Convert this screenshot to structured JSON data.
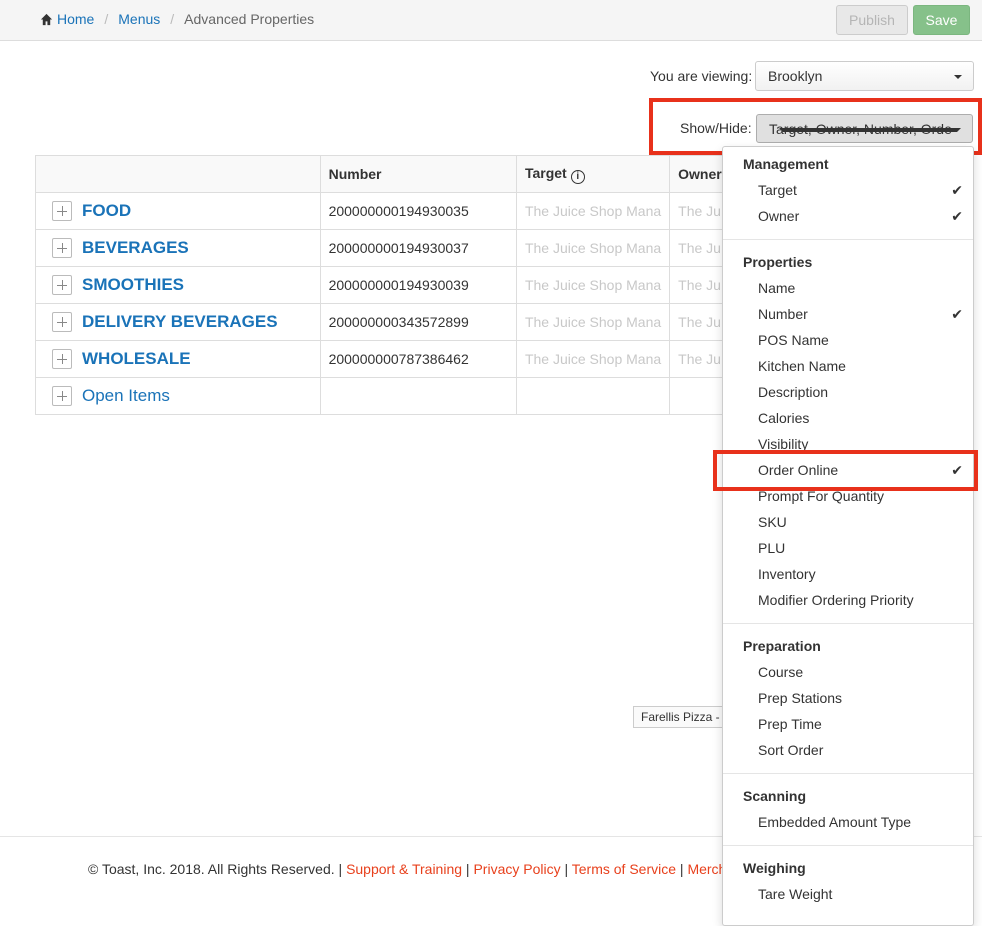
{
  "breadcrumb": {
    "home": "Home",
    "menus": "Menus",
    "current": "Advanced Properties"
  },
  "toolbar": {
    "publish_label": "Publish",
    "save_label": "Save"
  },
  "viewing": {
    "label": "You are viewing:",
    "value": "Brooklyn"
  },
  "showhide": {
    "label": "Show/Hide:",
    "value": "Target, Owner, Number, Order Online"
  },
  "table": {
    "headers": {
      "name": "",
      "number": "Number",
      "target": "Target",
      "owner": "Owner"
    },
    "rows": [
      {
        "name": "FOOD",
        "number": "200000000194930035",
        "target": "The Juice Shop Mana",
        "owner": "The Ju"
      },
      {
        "name": "BEVERAGES",
        "number": "200000000194930037",
        "target": "The Juice Shop Mana",
        "owner": "The Ju"
      },
      {
        "name": "SMOOTHIES",
        "number": "200000000194930039",
        "target": "The Juice Shop Mana",
        "owner": "The Ju"
      },
      {
        "name": "DELIVERY BEVERAGES",
        "number": "200000000343572899",
        "target": "The Juice Shop Mana",
        "owner": "The Ju"
      },
      {
        "name": "WHOLESALE",
        "number": "200000000787386462",
        "target": "The Juice Shop Mana",
        "owner": "The Ju"
      },
      {
        "name": "Open Items",
        "number": "",
        "target": "",
        "owner": ""
      }
    ]
  },
  "dropdown": {
    "management": {
      "header": "Management",
      "target": "Target",
      "owner": "Owner"
    },
    "properties": {
      "header": "Properties",
      "name": "Name",
      "number": "Number",
      "pos_name": "POS Name",
      "kitchen_name": "Kitchen Name",
      "description": "Description",
      "calories": "Calories",
      "visibility": "Visibility",
      "order_online": "Order Online",
      "prompt_quantity": "Prompt For Quantity",
      "sku": "SKU",
      "plu": "PLU",
      "inventory": "Inventory",
      "modifier_priority": "Modifier Ordering Priority"
    },
    "preparation": {
      "header": "Preparation",
      "course": "Course",
      "prep_stations": "Prep Stations",
      "prep_time": "Prep Time",
      "sort_order": "Sort Order"
    },
    "scanning": {
      "header": "Scanning",
      "embedded": "Embedded Amount Type"
    },
    "weighing": {
      "header": "Weighing",
      "tare": "Tare Weight"
    },
    "checkmark": "✔"
  },
  "tooltip": "Farellis Pizza - Asana",
  "footer": {
    "copyright": "© Toast, Inc. 2018. All Rights Reserved.",
    "sep": "|",
    "support": "Support & Training",
    "privacy": "Privacy Policy",
    "terms": "Terms of Service",
    "merchant": "Merch"
  },
  "colors": {
    "link": "#1a73b8",
    "highlight": "#e8311b",
    "save": "#86c18a",
    "footer_link": "#e8401c"
  }
}
